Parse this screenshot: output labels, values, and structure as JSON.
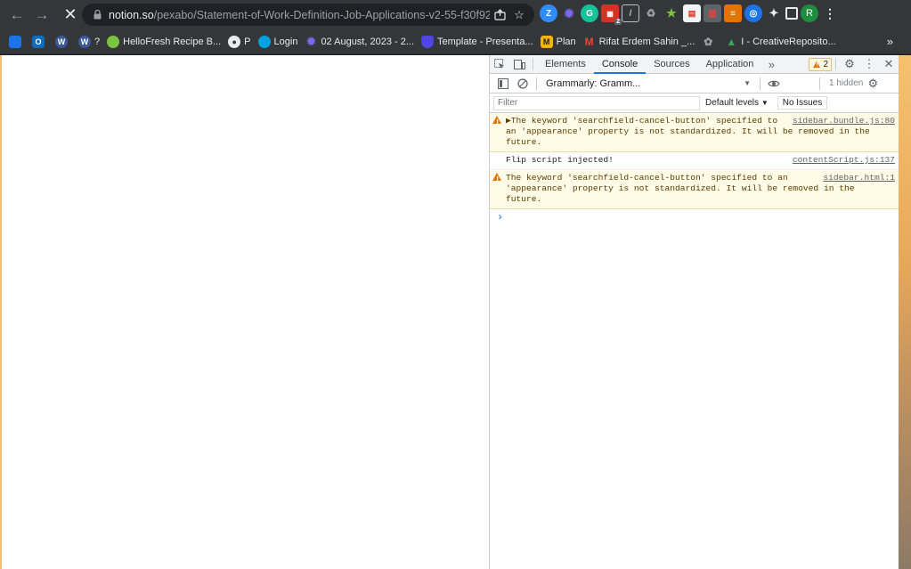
{
  "browser": {
    "url_domain": "notion.so",
    "url_path": "/pexabo/Statement-of-Work-Definition-Job-Applications-v2-55-f30f92d...",
    "profile_initial": "R",
    "extension_badge": "2"
  },
  "bookmarks": [
    {
      "label": "",
      "icon": "blue-square",
      "color": "#1a73e8"
    },
    {
      "label": "",
      "icon": "outlook-icon",
      "color": "#0f6cbd"
    },
    {
      "label": "",
      "icon": "wordpress-icon",
      "color": "#3b5998"
    },
    {
      "label": "?",
      "icon": "wordpress-icon",
      "color": "#3b5998"
    },
    {
      "label": "HelloFresh Recipe B...",
      "icon": "hellofresh-icon",
      "color": "#7cc243"
    },
    {
      "label": "P",
      "icon": "globe-icon",
      "color": "#9aa0a6"
    },
    {
      "label": "Login",
      "icon": "salesforce-icon",
      "color": "#00a1e0"
    },
    {
      "label": "02 August, 2023 - 2...",
      "icon": "gear-icon",
      "color": "#7b68ee"
    },
    {
      "label": "Template - Presenta...",
      "icon": "shield-icon",
      "color": "#4f46e5"
    },
    {
      "label": "Plan",
      "icon": "m-icon",
      "color": "#f4b400"
    },
    {
      "label": "Rifat Erdem Sahin _...",
      "icon": "gmail-icon",
      "color": "#ea4335"
    },
    {
      "label": "",
      "icon": "brain-icon",
      "color": "#9aa0a6"
    },
    {
      "label": "I - CreativeReposito...",
      "icon": "drive-icon",
      "color": "#34a853"
    }
  ],
  "devtools": {
    "tabs": [
      "Elements",
      "Console",
      "Sources",
      "Application"
    ],
    "active_tab": "Console",
    "warning_count": "2",
    "context": "Grammarly: Gramm...",
    "hidden_count": "1 hidden",
    "filter_placeholder": "Filter",
    "levels": "Default levels",
    "no_issues": "No Issues",
    "messages": [
      {
        "type": "warning",
        "text": "▶The keyword 'searchfield-cancel-button' specified to an 'appearance' property is not standardized. It will be removed in the future.",
        "source": "sidebar.bundle.js:80"
      },
      {
        "type": "info",
        "text": "Flip script injected!",
        "source": "contentScript.js:137"
      },
      {
        "type": "warning",
        "text": "The keyword 'searchfield-cancel-button' specified to an 'appearance' property is not standardized. It will be removed in the future.",
        "source": "sidebar.html:1"
      }
    ],
    "prompt_symbol": "›"
  }
}
